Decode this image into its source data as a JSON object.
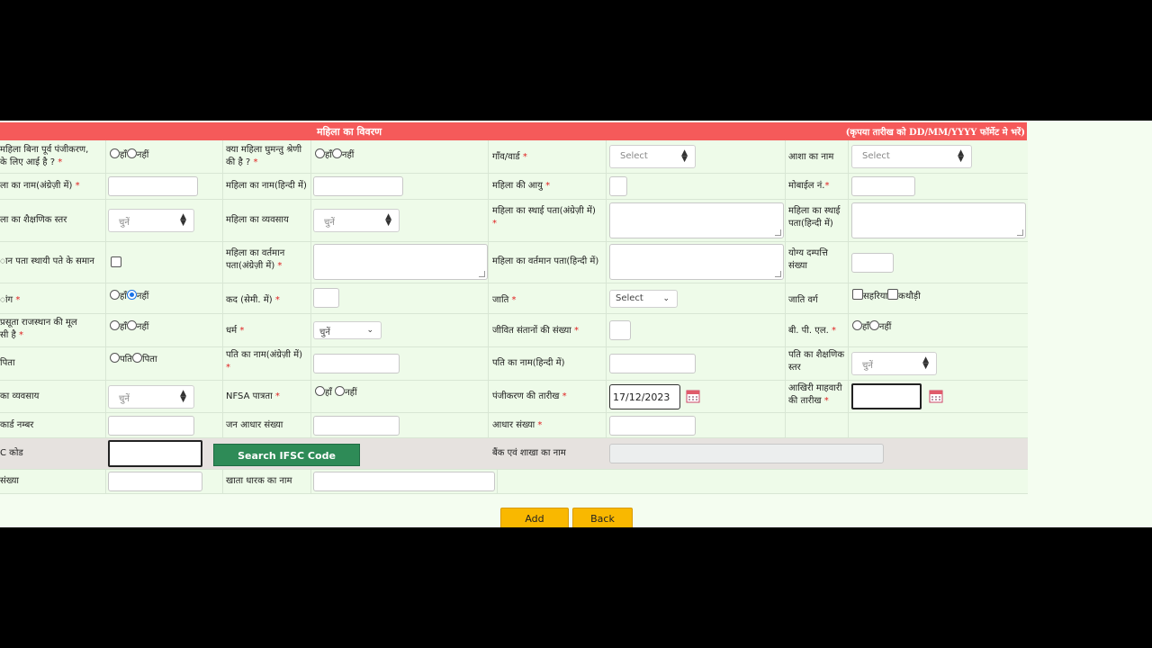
{
  "header": {
    "title": "महिला का विवरण",
    "note": "(कृपया तारीख को DD/MM/YYYY फॉर्मेट मे भरें)"
  },
  "labels": {
    "r1c1_a": "महिला बिना पूर्व पंजीकरण,",
    "r1c1_b": "के लिए आई है ?",
    "r1c2_a": "क्या महिला घुमन्तु श्रेणी",
    "r1c2_b": "की है ?",
    "village": "गाँव/वार्ड",
    "asha": "आशा का नाम",
    "name_en": "ला का नाम(अंग्रेज़ी में)",
    "name_hi": "महिला का नाम(हिन्दी में)",
    "age": "महिला की आयु",
    "mobile": "मोबाईल नं.",
    "edu": "ला का शैक्षणिक स्तर",
    "occupation": "महिला का व्यवसाय",
    "perm_addr_en_a": "महिला का स्थाई पता(अंग्रेज़ी में)",
    "perm_addr_hi_a": "महिला का स्थाई",
    "perm_addr_hi_b": "पता(हिन्दी में)",
    "same_addr": "ान पता स्थायी पते के समान",
    "cur_addr_en_a": "महिला का वर्तमान",
    "cur_addr_en_b": "पता(अंग्रेज़ी में)",
    "cur_addr_hi": "महिला का वर्तमान पता(हिन्दी में)",
    "eligible_a": "योग्य दम्पत्ति",
    "eligible_b": "संख्या",
    "disabled": "ांग",
    "height": "कद (सेमी. में)",
    "caste": "जाति",
    "caste_cat": "जाति वर्ग",
    "native_a": "प्रसूता राजस्थान की मूल",
    "native_b": "सी है",
    "religion": "धर्म",
    "living_children": "जीवित संतानों की संख्या",
    "bpl": "बी. पी. एल.",
    "guardian": "पिता",
    "husband_en_a": "पति का नाम(अंग्रेज़ी में)",
    "husband_hi": "पति का नाम(हिन्दी में)",
    "husband_edu_a": "पति का शैक्षणिक",
    "husband_edu_b": "स्तर",
    "husband_occ": "का व्यवसाय",
    "nfsa": "NFSA पात्रता",
    "reg_date": "पंजीकरण की तारीख",
    "lmp_a": "आखिरी माहवारी",
    "lmp_b": "की तारीख",
    "card_no": "कार्ड नम्बर",
    "jan_aadhaar": "जन आधार संख्या",
    "aadhaar": "आधार संख्या",
    "ifsc": "C कोड",
    "bank_name": "बैंक एवं शाखा का नाम",
    "acc_no": "संख्या",
    "acc_holder": "खाता धारक का नाम",
    "req": "*",
    "yes": "हाँ",
    "no": "नहीं",
    "husband": "पति",
    "father": "पिता",
    "sahariya": "सहरिया",
    "kathodi": "कथौड़ी"
  },
  "controls": {
    "select_en": "Select",
    "select_hi": "चुनें",
    "reg_date_value": "17/12/2023",
    "search_ifsc": "Search IFSC Code"
  },
  "buttons": {
    "add": "Add",
    "back": "Back"
  },
  "colors": {
    "header": "#f55a5a",
    "row_bg": "#eefbe9",
    "bank_row_bg": "#e6e2df",
    "green_button": "#2e8b57",
    "yellow_button": "#f9b800"
  }
}
